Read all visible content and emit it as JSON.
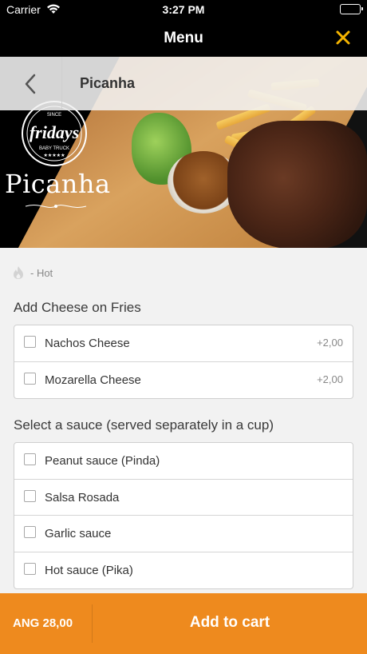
{
  "status_bar": {
    "carrier": "Carrier",
    "time": "3:27 PM"
  },
  "nav": {
    "title": "Menu",
    "close_icon": "close-icon"
  },
  "hero": {
    "product_name": "Picanha",
    "dish_title": "Picanha",
    "logo_text": "fridays",
    "logo_since": "SINCE",
    "logo_sub": "BABY TRUCK",
    "back_icon": "chevron-left-icon"
  },
  "legend": {
    "icon": "flame-icon",
    "text": "- Hot"
  },
  "sections": [
    {
      "title": "Add Cheese on Fries",
      "options": [
        {
          "label": "Nachos Cheese",
          "price": "+2,00"
        },
        {
          "label": "Mozarella Cheese",
          "price": "+2,00"
        }
      ]
    },
    {
      "title": "Select a sauce (served separately in a cup)",
      "options": [
        {
          "label": "Peanut sauce (Pinda)",
          "price": ""
        },
        {
          "label": "Salsa Rosada",
          "price": ""
        },
        {
          "label": "Garlic sauce",
          "price": ""
        },
        {
          "label": "Hot sauce (Pika)",
          "price": ""
        }
      ]
    }
  ],
  "cart": {
    "total": "ANG 28,00",
    "button_label": "Add to cart"
  },
  "colors": {
    "accent": "#ee8a1e",
    "close_icon": "#f5b400",
    "nav_bg": "#000000"
  }
}
